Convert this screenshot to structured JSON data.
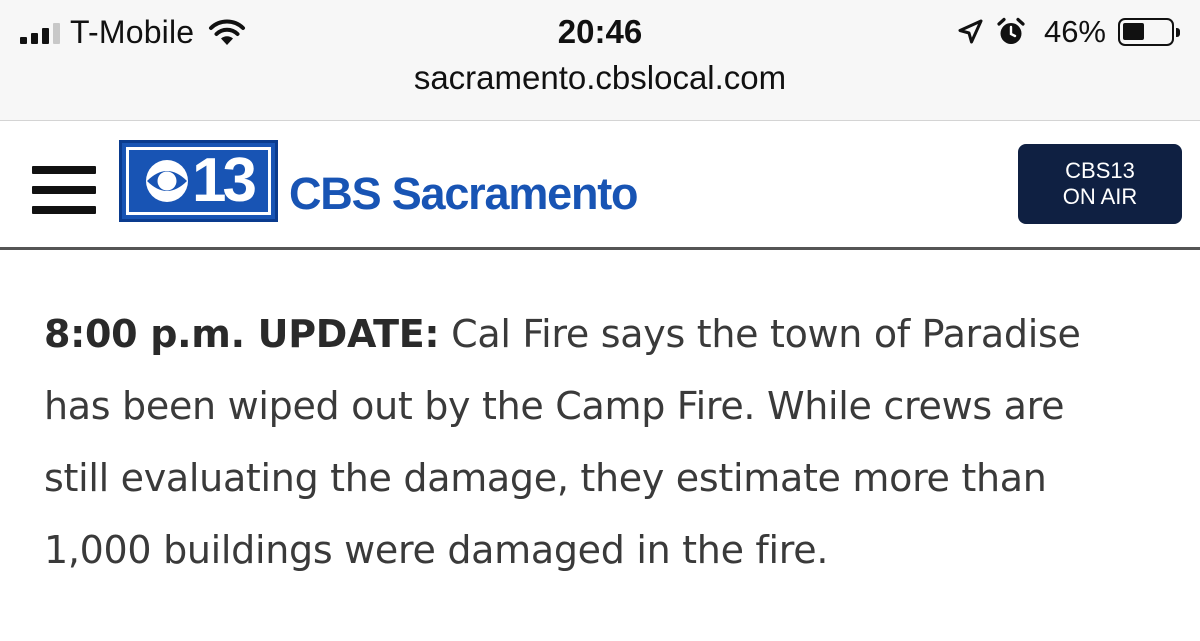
{
  "status_bar": {
    "carrier": "T-Mobile",
    "time": "20:46",
    "battery_percent_label": "46%",
    "battery_level": 0.46,
    "icons": [
      "signal-icon",
      "wifi-icon",
      "location-arrow-icon",
      "alarm-icon",
      "battery-icon"
    ]
  },
  "browser": {
    "url": "sacramento.cbslocal.com"
  },
  "header": {
    "logo_number": "13",
    "brand_name": "CBS Sacramento",
    "on_air_line1": "CBS13",
    "on_air_line2": "ON AIR",
    "brand_color": "#1854b4",
    "on_air_color": "#0f2042",
    "icons": [
      "hamburger-menu-icon",
      "cbs-eye-icon"
    ]
  },
  "article": {
    "lead": "8:00 p.m. UPDATE:",
    "line1_rest": "Cal Fire says the town of Paradise",
    "line2": "has been wiped out by the Camp Fire. While crews are",
    "line3": "still evaluating the damage, they estimate more than",
    "line4": "1,000 buildings were damaged in the fire."
  }
}
